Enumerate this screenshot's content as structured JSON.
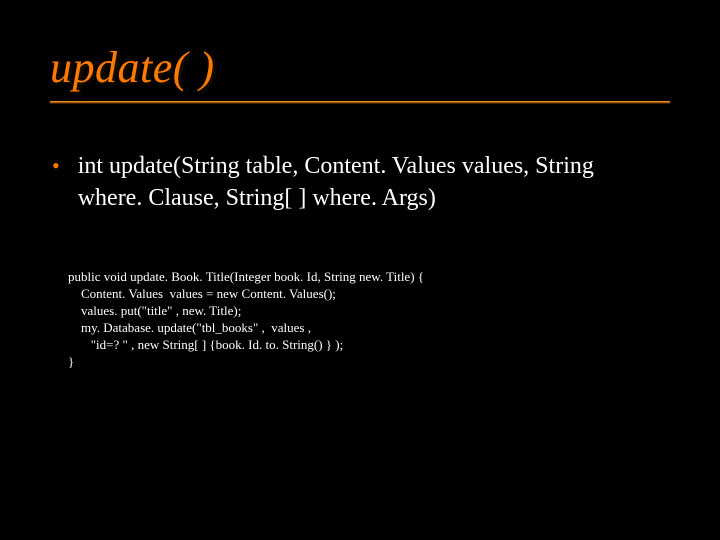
{
  "title": "update( )",
  "bullet": {
    "marker": "•",
    "line1": "int  update(String table, Content. Values values, String",
    "line2": "where. Clause, String[ ] where. Args)"
  },
  "code": {
    "l1": "public void update. Book. Title(Integer book. Id, String new. Title) {",
    "l2": "    Content. Values  values = new Content. Values();",
    "l3": "    values. put(\"title\" , new. Title);",
    "l4": "    my. Database. update(\"tbl_books\" ,  values ,",
    "l5": "       \"id=? \" , new String[ ] {book. Id. to. String() } );",
    "l6": "}"
  }
}
